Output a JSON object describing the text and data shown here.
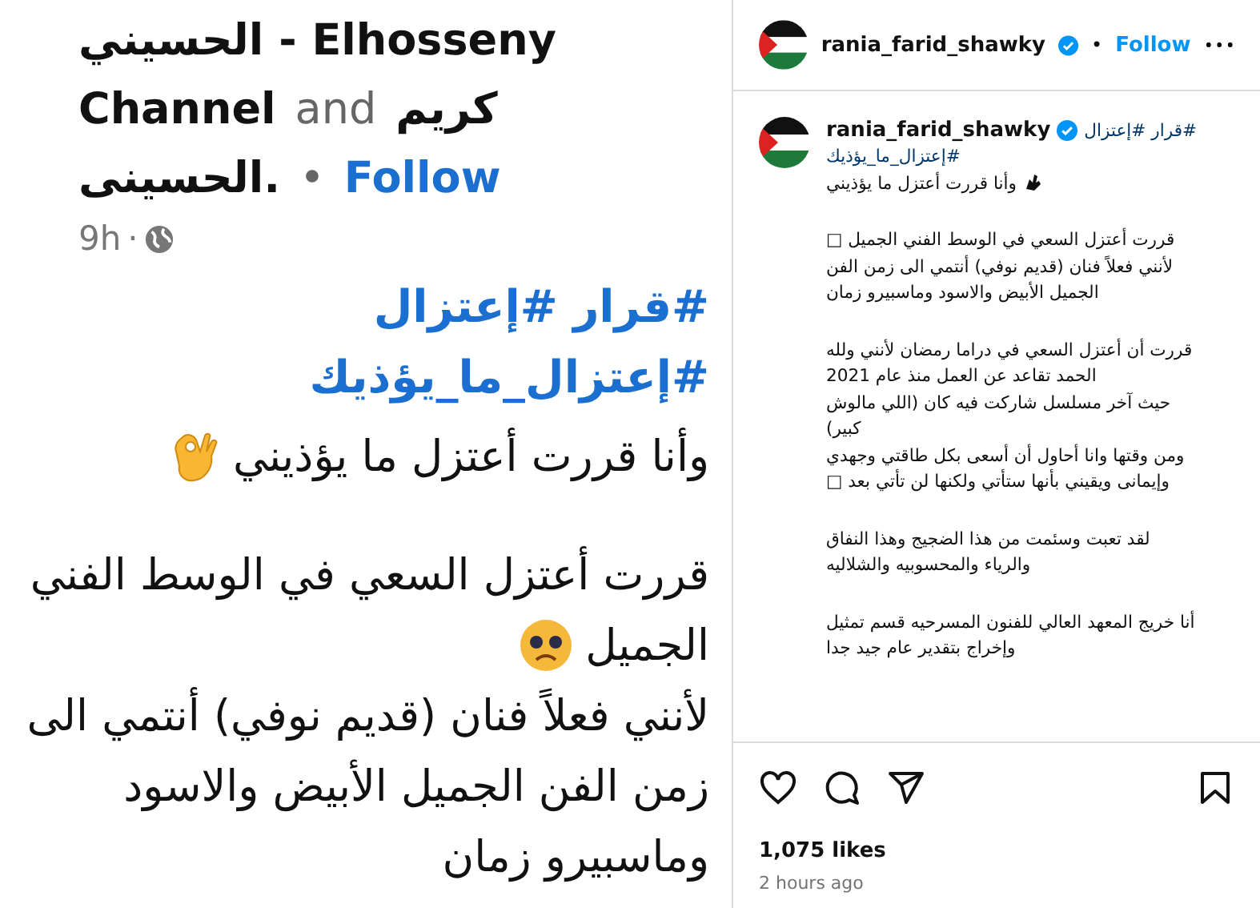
{
  "shared_post": {
    "header_lines": [
      [
        {
          "kind": "name",
          "text": "الحسيني - Elhosseny"
        }
      ],
      [
        {
          "kind": "name",
          "text": "كريم"
        },
        {
          "kind": "muted",
          "text": "and"
        },
        {
          "kind": "name",
          "text": "Channel"
        }
      ],
      [
        {
          "kind": "link",
          "text": "Follow"
        },
        {
          "kind": "muted",
          "text": "•"
        },
        {
          "kind": "name",
          "text": "الحسينى."
        }
      ]
    ],
    "time": "9h",
    "time_separator": "·",
    "hashtag_lines": [
      "#قرار #إعتزال",
      "#إعتزال_ما_يؤذيك"
    ],
    "paragraphs": [
      [
        {
          "text": "وأنا قررت أعتزل ما يؤذيني",
          "kind": "ok_hand"
        }
      ],
      [
        {
          "text": "قررت أعتزل السعي في الوسط الفني"
        },
        {
          "text": "الجميل",
          "kind": "sad"
        },
        {
          "text": "لأنني فعلاً فنان (قديم نوفي) أنتمي الى"
        },
        {
          "text": "زمن الفن الجميل الأبيض والاسود"
        },
        {
          "text": "وماسبيرو زمان"
        }
      ]
    ]
  },
  "post_header": {
    "username": "rania_farid_shawky",
    "verified": true,
    "separator": "•",
    "follow": "Follow"
  },
  "caption": {
    "username": "rania_farid_shawky",
    "verified": true,
    "hashtags": "#قرار #إعتزال",
    "hashtags_line_2": "#إعتزال_ما_يؤذيك",
    "paragraphs": [
      [
        {
          "text": "وأنا قررت أعتزل ما يؤذيني",
          "kind": "hand"
        }
      ],
      [
        {
          "text": "قررت أعتزل السعي في الوسط الفني الجميل □"
        },
        {
          "text": "لأنني فعلاً فنان (قديم نوفي) أنتمي الى زمن الفن"
        },
        {
          "text": "الجميل الأبيض والاسود وماسبيرو زمان"
        }
      ],
      [
        {
          "text": "قررت أن أعتزل السعي في دراما رمضان لأنني ولله"
        },
        {
          "text": "الحمد تقاعد عن العمل منذ عام 2021"
        },
        {
          "text": "حيث آخر مسلسل شاركت فيه كان (اللي مالوش"
        },
        {
          "text": "كبير)"
        },
        {
          "text": "ومن وقتها وانا أحاول أن أسعى بكل طاقتي وجهدي"
        },
        {
          "text": "وإيمانى ويقيني بأنها ستأتي ولكنها لن تأتي بعد □"
        }
      ],
      [
        {
          "text": "لقد تعبت وسئمت من هذا الضجيج وهذا النفاق"
        },
        {
          "text": "والرياء والمحسوبيه والشلاليه"
        }
      ],
      [
        {
          "text": "أنا خريج المعهد العالي للفنون المسرحيه قسم تمثيل"
        },
        {
          "text": "وإخراج بتقدير عام جيد جدا"
        }
      ]
    ]
  },
  "likes": "1,075 likes",
  "time": "2 hours ago"
}
